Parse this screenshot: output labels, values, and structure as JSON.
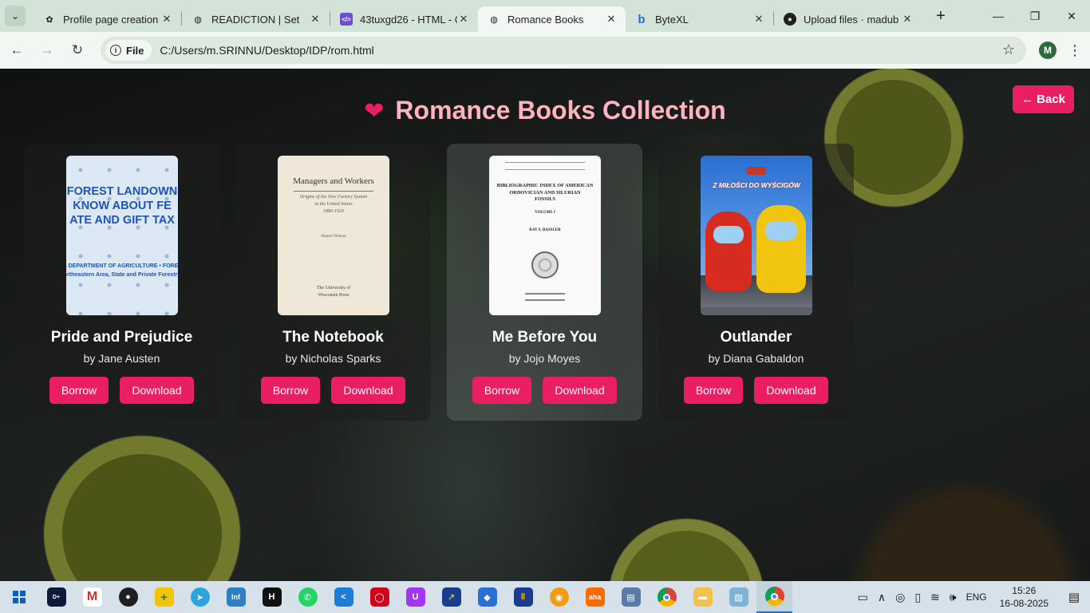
{
  "browser": {
    "tabs": [
      {
        "title": "Profile page creation",
        "icon": "openai-icon",
        "active": false
      },
      {
        "title": "READICTION | Set",
        "icon": "globe-icon",
        "active": false
      },
      {
        "title": "43tuxgd26 - HTML - C",
        "icon": "code-icon",
        "active": false
      },
      {
        "title": "Romance Books",
        "icon": "globe-icon",
        "active": true
      },
      {
        "title": "ByteXL",
        "icon": "bytexl-icon",
        "active": false
      },
      {
        "title": "Upload files · madub",
        "icon": "github-icon",
        "active": false
      }
    ],
    "address_chip": "File",
    "url": "C:/Users/m.SRINNU/Desktop/IDP/rom.html",
    "profile_initial": "M"
  },
  "page": {
    "title": "Romance Books Collection",
    "back_label": "← Back",
    "accent_color": "#e91e63",
    "title_color": "#ffb3c1"
  },
  "books": [
    {
      "title": "Pride and Prejudice",
      "author": "by Jane Austen",
      "borrow_label": "Borrow",
      "download_label": "Download",
      "cover": {
        "lines": [
          "FOREST LANDOWN",
          "KNOW ABOUT FE",
          "ATE AND GIFT TAX"
        ],
        "sub": [
          "S DEPARTMENT OF AGRICULTURE • FORES",
          "ortheastern Area, State and Private Forestry"
        ]
      }
    },
    {
      "title": "The Notebook",
      "author": "by Nicholas Sparks",
      "borrow_label": "Borrow",
      "download_label": "Download",
      "cover": {
        "heading": "Managers and Workers",
        "sub": [
          "Origins of the New Factory System",
          "in the United States",
          "1880-1920"
        ],
        "author": "Daniel Nelson",
        "publisher": [
          "The University of",
          "Wisconsin Press"
        ]
      }
    },
    {
      "title": "Me Before You",
      "author": "by Jojo Moyes",
      "borrow_label": "Borrow",
      "download_label": "Download",
      "cover": {
        "heading": [
          "BIBLIOGRAPHIC INDEX OF AMERICAN",
          "ORDOVICIAN AND SILURIAN",
          "FOSSILS"
        ],
        "volume": "VOLUME I",
        "author": "RAY S. BASSLER"
      }
    },
    {
      "title": "Outlander",
      "author": "by Diana Gabaldon",
      "borrow_label": "Borrow",
      "download_label": "Download",
      "cover": {
        "heading": "Z MIŁOŚCI DO WYŚCIGÓW"
      }
    }
  ],
  "taskbar": {
    "apps": [
      "disney-hotstar-icon",
      "gmail-icon",
      "github-icon",
      "app-icon",
      "telegram-icon",
      "infosys-icon",
      "hackerrank-icon",
      "whatsapp-icon",
      "vscode-icon",
      "oracle-icon",
      "udemy-icon",
      "app-icon",
      "app-icon",
      "app-icon",
      "app-icon",
      "aha-icon",
      "app-icon",
      "chrome-icon",
      "file-explorer-icon",
      "app-icon",
      "chrome-profile-icon"
    ],
    "language": "ENG",
    "time": "15:26",
    "date": "16-08-2025"
  }
}
